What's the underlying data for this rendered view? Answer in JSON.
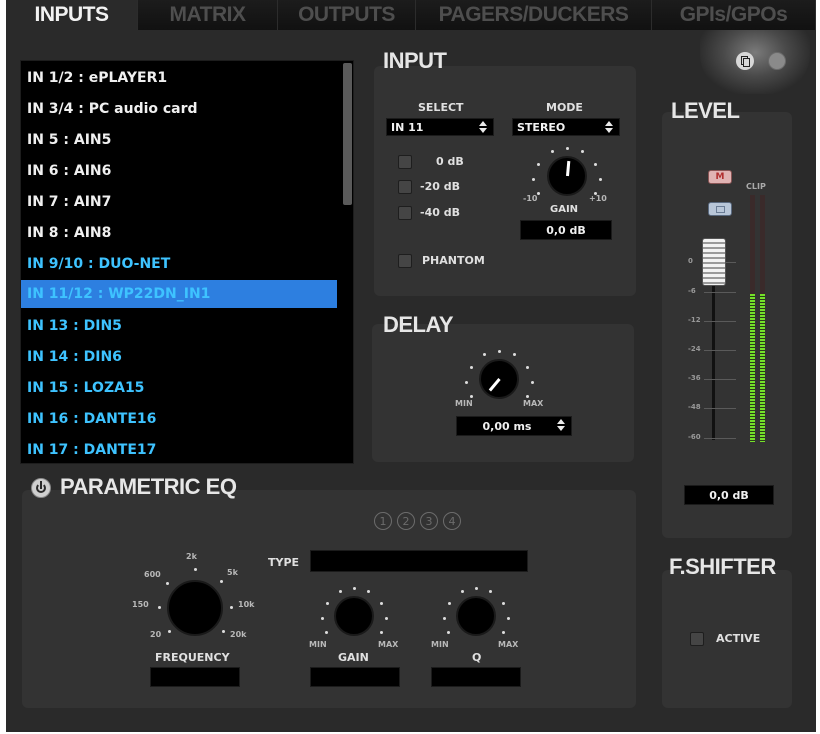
{
  "tabs": [
    {
      "label": "INPUTS"
    },
    {
      "label": "MATRIX"
    },
    {
      "label": "OUTPUTS"
    },
    {
      "label": "PAGERS/DUCKERS"
    },
    {
      "label": "GPIs/GPOs"
    }
  ],
  "inputs_list": [
    {
      "label": "IN 1/2 : ePLAYER1"
    },
    {
      "label": "IN 3/4 : PC audio card"
    },
    {
      "label": "IN 5 : AIN5"
    },
    {
      "label": "IN 6 : AIN6"
    },
    {
      "label": "IN 7 : AIN7"
    },
    {
      "label": "IN 8 : AIN8"
    },
    {
      "label": "IN 9/10 : DUO-NET"
    },
    {
      "label": "IN 11/12 : WP22DN_IN1"
    },
    {
      "label": "IN 13 : DIN5"
    },
    {
      "label": "IN 14 : DIN6"
    },
    {
      "label": "IN 15 : LOZA15"
    },
    {
      "label": "IN 16 : DANTE16"
    },
    {
      "label": "IN 17 : DANTE17"
    }
  ],
  "input": {
    "title": "INPUT",
    "select_label": "SELECT",
    "select_value": "IN 11",
    "mode_label": "MODE",
    "mode_value": "STEREO",
    "atten_options": [
      "0 dB",
      "-20 dB",
      "-40 dB"
    ],
    "phantom_label": "PHANTOM",
    "gain_label": "GAIN",
    "gain_min": "-10",
    "gain_max": "+10",
    "gain_value": "0,0 dB"
  },
  "delay": {
    "title": "DELAY",
    "min_label": "MIN",
    "max_label": "MAX",
    "value": "0,00 ms"
  },
  "level": {
    "title": "LEVEL",
    "mute_label": "M",
    "clip_label": "CLIP",
    "scale": [
      "0",
      "-6",
      "-12",
      "-24",
      "-36",
      "-48",
      "-60"
    ],
    "value": "0,0 dB",
    "meter_fill": 0.6
  },
  "fshifter": {
    "title": "F.SHIFTER",
    "active_label": "ACTIVE"
  },
  "eq": {
    "title": "PARAMETRIC EQ",
    "bands": [
      "1",
      "2",
      "3",
      "4"
    ],
    "type_label": "TYPE",
    "freq_label": "FREQUENCY",
    "freq_scale": [
      "20",
      "150",
      "600",
      "2k",
      "5k",
      "10k",
      "20k"
    ],
    "gain_label": "GAIN",
    "q_label": "Q",
    "min_label": "MIN",
    "max_label": "MAX"
  },
  "colors": {
    "selected_row": "#2d7fe0",
    "network_input_text": "#3ec3ff",
    "meter_green": "#74e02a"
  }
}
